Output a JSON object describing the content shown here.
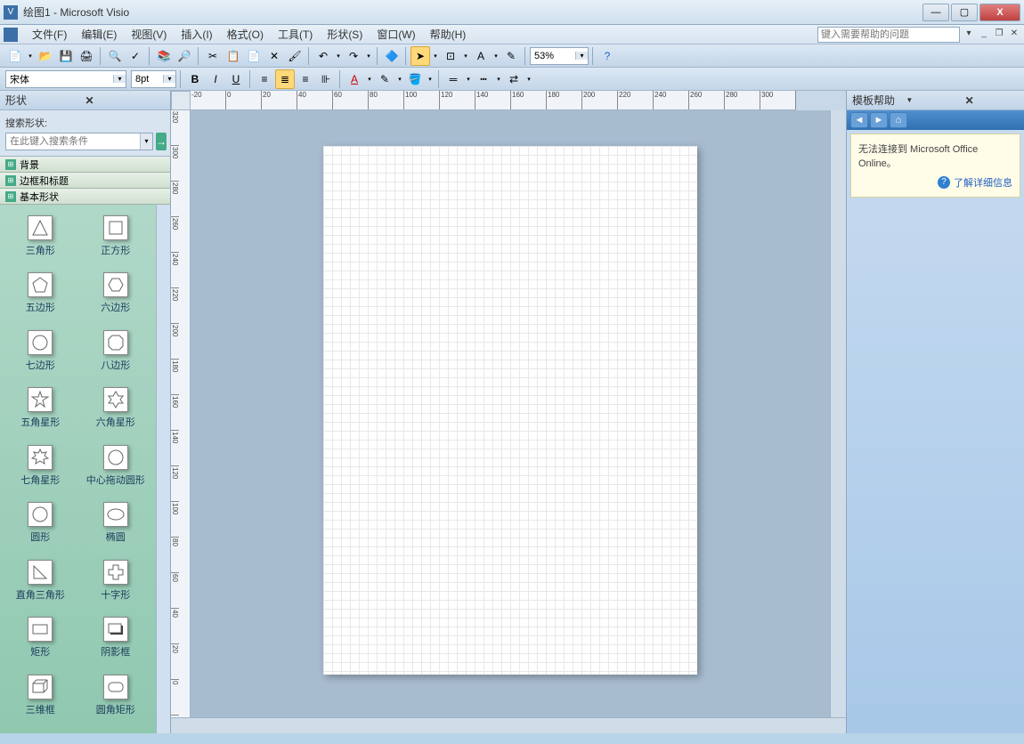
{
  "title": "绘图1 - Microsoft Visio",
  "window": {
    "min": "—",
    "max": "▢",
    "close": "X"
  },
  "menu": [
    "文件(F)",
    "编辑(E)",
    "视图(V)",
    "插入(I)",
    "格式(O)",
    "工具(T)",
    "形状(S)",
    "窗口(W)",
    "帮助(H)"
  ],
  "help_placeholder": "键入需要帮助的问题",
  "toolbar1": {
    "zoom": "53%"
  },
  "toolbar2": {
    "font": "宋体",
    "size": "8pt"
  },
  "shapes_panel": {
    "title": "形状",
    "search_label": "搜索形状:",
    "search_placeholder": "在此键入搜索条件",
    "stencils": [
      "背景",
      "边框和标题",
      "基本形状"
    ],
    "shapes": [
      {
        "name": "三角形",
        "svg": "triangle"
      },
      {
        "name": "正方形",
        "svg": "square"
      },
      {
        "name": "五边形",
        "svg": "pentagon"
      },
      {
        "name": "六边形",
        "svg": "hexagon"
      },
      {
        "name": "七边形",
        "svg": "heptagon"
      },
      {
        "name": "八边形",
        "svg": "octagon"
      },
      {
        "name": "五角星形",
        "svg": "star5"
      },
      {
        "name": "六角星形",
        "svg": "star6"
      },
      {
        "name": "七角星形",
        "svg": "star7"
      },
      {
        "name": "中心拖动圆形",
        "svg": "circle"
      },
      {
        "name": "圆形",
        "svg": "circle"
      },
      {
        "name": "椭圆",
        "svg": "ellipse"
      },
      {
        "name": "直角三角形",
        "svg": "rtriangle"
      },
      {
        "name": "十字形",
        "svg": "cross"
      },
      {
        "name": "矩形",
        "svg": "rect"
      },
      {
        "name": "阴影框",
        "svg": "shadowbox"
      },
      {
        "name": "三维框",
        "svg": "box3d"
      },
      {
        "name": "圆角矩形",
        "svg": "roundrect"
      }
    ]
  },
  "help_pane": {
    "title": "模板帮助",
    "message": "无法连接到 Microsoft Office Online。",
    "link": "了解详细信息"
  },
  "ruler_h": [
    "-20",
    "0",
    "20",
    "40",
    "60",
    "80",
    "100",
    "120",
    "140",
    "160",
    "180",
    "200",
    "220",
    "240",
    "260",
    "280",
    "300"
  ],
  "ruler_v": [
    "320",
    "300",
    "280",
    "260",
    "240",
    "220",
    "200",
    "180",
    "160",
    "140",
    "120",
    "100",
    "80",
    "60",
    "40",
    "20",
    "0"
  ]
}
